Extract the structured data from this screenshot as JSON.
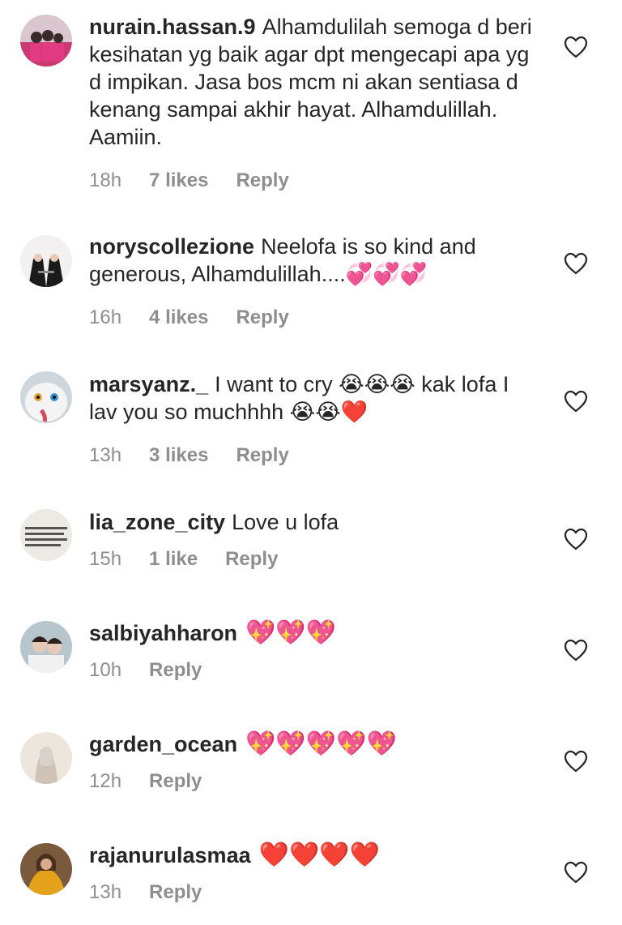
{
  "comments": [
    {
      "username": "nurain.hassan.9",
      "message": "Alhamdulilah semoga d beri kesihatan yg baik agar dpt mengecapi apa yg d impikan. Jasa bos mcm ni akan sentiasa d kenang sampai akhir hayat. Alhamdulillah. Aamiin.",
      "time": "18h",
      "likes": "7 likes",
      "reply": "Reply"
    },
    {
      "username": "noryscollezione",
      "message": "Neelofa is so kind and generous, Alhamdulillah....💞💞💞",
      "time": "16h",
      "likes": "4 likes",
      "reply": "Reply"
    },
    {
      "username": "marsyanz._",
      "message": "I want to cry 😭😭😭 kak lofa I lav you so muchhhh 😭😭❤️",
      "time": "13h",
      "likes": "3 likes",
      "reply": "Reply"
    },
    {
      "username": "lia_zone_city",
      "message": "Love u lofa",
      "time": "15h",
      "likes": "1 like",
      "reply": "Reply"
    },
    {
      "username": "salbiyahharon",
      "message": "💖💖💖",
      "time": "10h",
      "likes": "",
      "reply": "Reply"
    },
    {
      "username": "garden_ocean",
      "message": "💖💖💖💖💖",
      "time": "12h",
      "likes": "",
      "reply": "Reply"
    },
    {
      "username": "rajanurulasmaa",
      "message": "❤️❤️❤️❤️",
      "time": "13h",
      "likes": "",
      "reply": "Reply"
    }
  ],
  "icons": {
    "like": "heart-outline-icon"
  },
  "colors": {
    "text": "#262626",
    "meta": "#8e8e8e",
    "heart_stroke": "#262626"
  }
}
